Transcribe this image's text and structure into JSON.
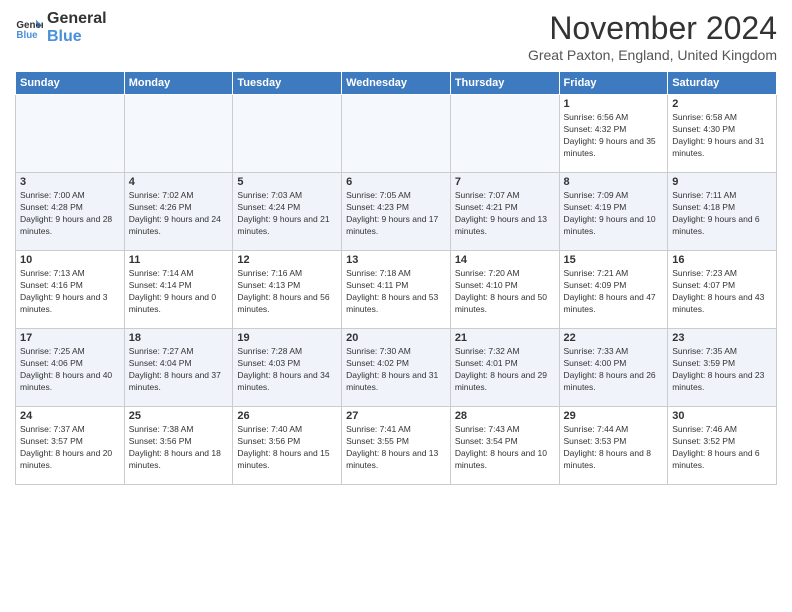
{
  "logo": {
    "text_general": "General",
    "text_blue": "Blue"
  },
  "header": {
    "month": "November 2024",
    "location": "Great Paxton, England, United Kingdom"
  },
  "days_of_week": [
    "Sunday",
    "Monday",
    "Tuesday",
    "Wednesday",
    "Thursday",
    "Friday",
    "Saturday"
  ],
  "weeks": [
    [
      {
        "day": "",
        "info": ""
      },
      {
        "day": "",
        "info": ""
      },
      {
        "day": "",
        "info": ""
      },
      {
        "day": "",
        "info": ""
      },
      {
        "day": "",
        "info": ""
      },
      {
        "day": "1",
        "info": "Sunrise: 6:56 AM\nSunset: 4:32 PM\nDaylight: 9 hours and 35 minutes."
      },
      {
        "day": "2",
        "info": "Sunrise: 6:58 AM\nSunset: 4:30 PM\nDaylight: 9 hours and 31 minutes."
      }
    ],
    [
      {
        "day": "3",
        "info": "Sunrise: 7:00 AM\nSunset: 4:28 PM\nDaylight: 9 hours and 28 minutes."
      },
      {
        "day": "4",
        "info": "Sunrise: 7:02 AM\nSunset: 4:26 PM\nDaylight: 9 hours and 24 minutes."
      },
      {
        "day": "5",
        "info": "Sunrise: 7:03 AM\nSunset: 4:24 PM\nDaylight: 9 hours and 21 minutes."
      },
      {
        "day": "6",
        "info": "Sunrise: 7:05 AM\nSunset: 4:23 PM\nDaylight: 9 hours and 17 minutes."
      },
      {
        "day": "7",
        "info": "Sunrise: 7:07 AM\nSunset: 4:21 PM\nDaylight: 9 hours and 13 minutes."
      },
      {
        "day": "8",
        "info": "Sunrise: 7:09 AM\nSunset: 4:19 PM\nDaylight: 9 hours and 10 minutes."
      },
      {
        "day": "9",
        "info": "Sunrise: 7:11 AM\nSunset: 4:18 PM\nDaylight: 9 hours and 6 minutes."
      }
    ],
    [
      {
        "day": "10",
        "info": "Sunrise: 7:13 AM\nSunset: 4:16 PM\nDaylight: 9 hours and 3 minutes."
      },
      {
        "day": "11",
        "info": "Sunrise: 7:14 AM\nSunset: 4:14 PM\nDaylight: 9 hours and 0 minutes."
      },
      {
        "day": "12",
        "info": "Sunrise: 7:16 AM\nSunset: 4:13 PM\nDaylight: 8 hours and 56 minutes."
      },
      {
        "day": "13",
        "info": "Sunrise: 7:18 AM\nSunset: 4:11 PM\nDaylight: 8 hours and 53 minutes."
      },
      {
        "day": "14",
        "info": "Sunrise: 7:20 AM\nSunset: 4:10 PM\nDaylight: 8 hours and 50 minutes."
      },
      {
        "day": "15",
        "info": "Sunrise: 7:21 AM\nSunset: 4:09 PM\nDaylight: 8 hours and 47 minutes."
      },
      {
        "day": "16",
        "info": "Sunrise: 7:23 AM\nSunset: 4:07 PM\nDaylight: 8 hours and 43 minutes."
      }
    ],
    [
      {
        "day": "17",
        "info": "Sunrise: 7:25 AM\nSunset: 4:06 PM\nDaylight: 8 hours and 40 minutes."
      },
      {
        "day": "18",
        "info": "Sunrise: 7:27 AM\nSunset: 4:04 PM\nDaylight: 8 hours and 37 minutes."
      },
      {
        "day": "19",
        "info": "Sunrise: 7:28 AM\nSunset: 4:03 PM\nDaylight: 8 hours and 34 minutes."
      },
      {
        "day": "20",
        "info": "Sunrise: 7:30 AM\nSunset: 4:02 PM\nDaylight: 8 hours and 31 minutes."
      },
      {
        "day": "21",
        "info": "Sunrise: 7:32 AM\nSunset: 4:01 PM\nDaylight: 8 hours and 29 minutes."
      },
      {
        "day": "22",
        "info": "Sunrise: 7:33 AM\nSunset: 4:00 PM\nDaylight: 8 hours and 26 minutes."
      },
      {
        "day": "23",
        "info": "Sunrise: 7:35 AM\nSunset: 3:59 PM\nDaylight: 8 hours and 23 minutes."
      }
    ],
    [
      {
        "day": "24",
        "info": "Sunrise: 7:37 AM\nSunset: 3:57 PM\nDaylight: 8 hours and 20 minutes."
      },
      {
        "day": "25",
        "info": "Sunrise: 7:38 AM\nSunset: 3:56 PM\nDaylight: 8 hours and 18 minutes."
      },
      {
        "day": "26",
        "info": "Sunrise: 7:40 AM\nSunset: 3:56 PM\nDaylight: 8 hours and 15 minutes."
      },
      {
        "day": "27",
        "info": "Sunrise: 7:41 AM\nSunset: 3:55 PM\nDaylight: 8 hours and 13 minutes."
      },
      {
        "day": "28",
        "info": "Sunrise: 7:43 AM\nSunset: 3:54 PM\nDaylight: 8 hours and 10 minutes."
      },
      {
        "day": "29",
        "info": "Sunrise: 7:44 AM\nSunset: 3:53 PM\nDaylight: 8 hours and 8 minutes."
      },
      {
        "day": "30",
        "info": "Sunrise: 7:46 AM\nSunset: 3:52 PM\nDaylight: 8 hours and 6 minutes."
      }
    ]
  ]
}
